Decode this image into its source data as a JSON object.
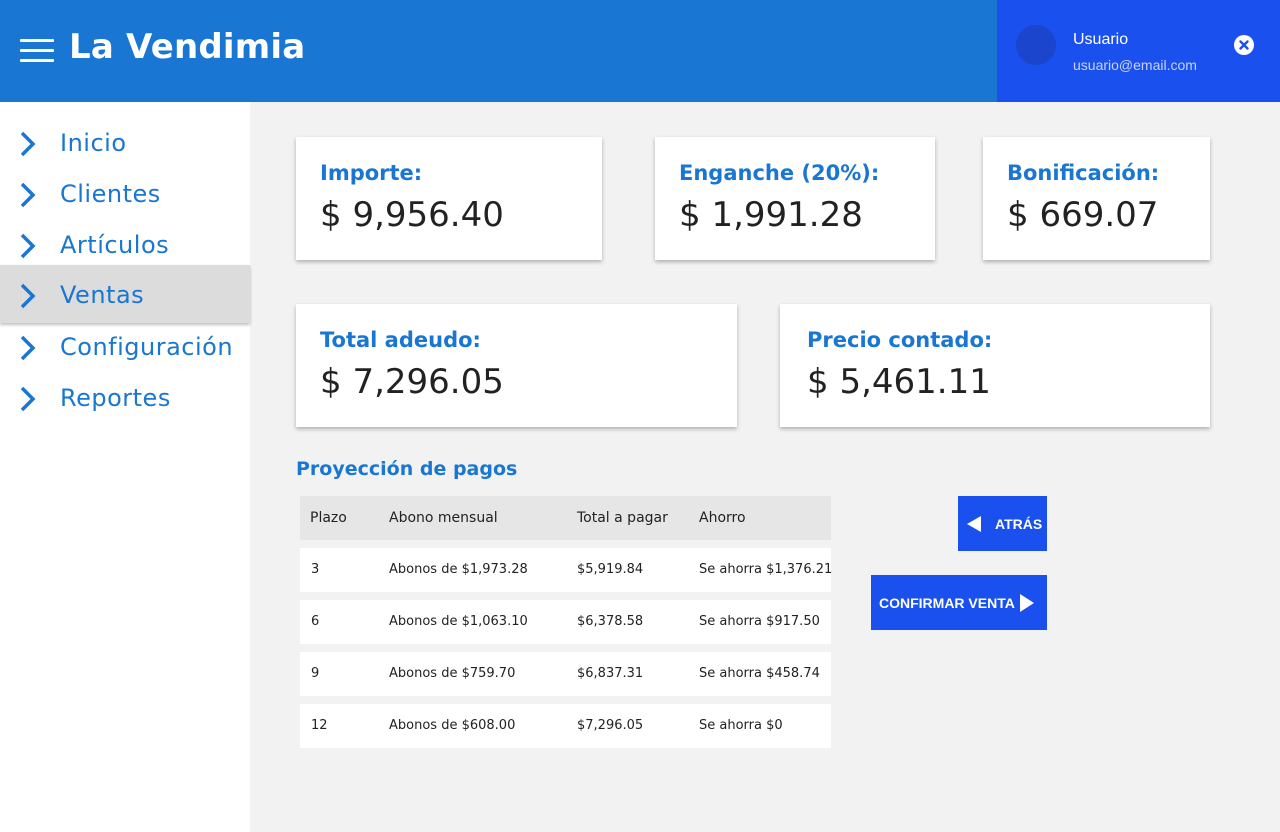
{
  "app": {
    "title": "La Vendimia"
  },
  "user": {
    "name": "Usuario",
    "email": "usuario@email.com"
  },
  "sidebar": {
    "items": [
      {
        "label": "Inicio",
        "active": false
      },
      {
        "label": "Clientes",
        "active": false
      },
      {
        "label": "Artículos",
        "active": false
      },
      {
        "label": "Ventas",
        "active": true
      },
      {
        "label": "Configuración",
        "active": false
      },
      {
        "label": "Reportes",
        "active": false
      }
    ]
  },
  "summary": {
    "importe": {
      "label": "Importe:",
      "value": "$ 9,956.40"
    },
    "enganche": {
      "label": "Enganche (20%):",
      "value": "$ 1,991.28"
    },
    "bonificacion": {
      "label": "Bonificación:",
      "value": "$ 669.07"
    },
    "total_adeudo": {
      "label": "Total adeudo:",
      "value": "$ 7,296.05"
    },
    "precio_contado": {
      "label": "Precio contado:",
      "value": "$ 5,461.11"
    }
  },
  "projection": {
    "title": "Proyección de pagos",
    "headers": [
      "Plazo",
      "Abono mensual",
      "Total a pagar",
      "Ahorro"
    ],
    "rows": [
      [
        "3",
        "Abonos de $1,973.28",
        "$5,919.84",
        "Se ahorra $1,376.21"
      ],
      [
        "6",
        "Abonos de $1,063.10",
        "$6,378.58",
        "Se ahorra $917.50"
      ],
      [
        "9",
        "Abonos de $759.70",
        "$6,837.31",
        "Se ahorra $458.74"
      ],
      [
        "12",
        "Abonos de $608.00",
        "$7,296.05",
        "Se ahorra $0"
      ]
    ]
  },
  "actions": {
    "back_label": "ATRÁS",
    "confirm_label": "CONFIRMAR VENTA"
  },
  "colors": {
    "primary": "#1976d2",
    "accent": "#1a50ee",
    "active_nav": "#dcdcdc",
    "background": "#f2f2f2"
  }
}
